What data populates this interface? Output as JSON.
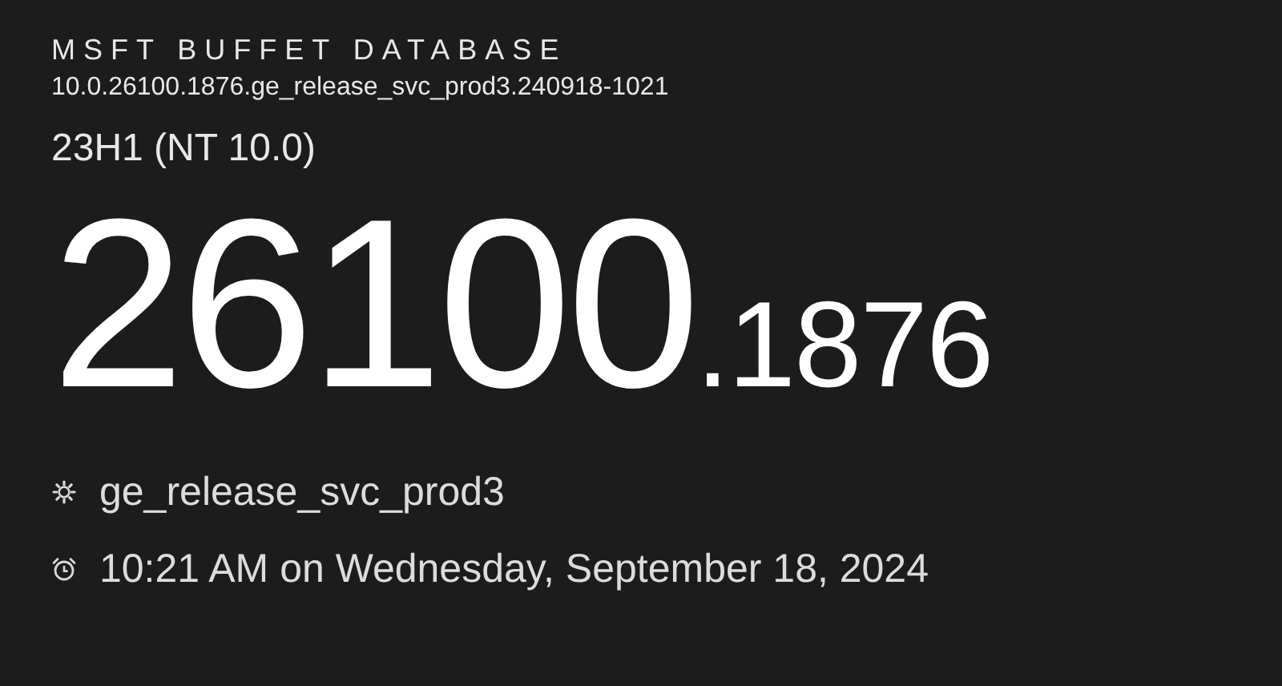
{
  "header": {
    "title": "MSFT BUFFET DATABASE",
    "build_string": "10.0.26100.1876.ge_release_svc_prod3.240918-1021",
    "version": "23H1 (NT 10.0)"
  },
  "build": {
    "major": "26100",
    "minor": ".1876"
  },
  "details": [
    {
      "kind": "branch",
      "text": "ge_release_svc_prod3"
    },
    {
      "kind": "compiled",
      "text": "10:21 AM on Wednesday, September 18, 2024"
    }
  ]
}
